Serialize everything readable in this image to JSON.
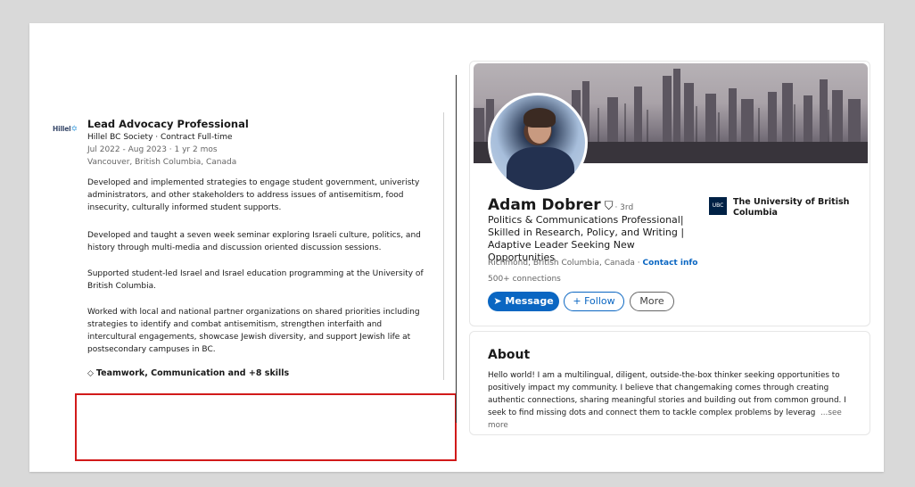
{
  "experience": {
    "logo_text": "Hillel",
    "title": "Lead Advocacy Professional",
    "company": "Hillel BC Society · Contract Full-time",
    "dates": "Jul 2022 - Aug 2023 · 1 yr 2 mos",
    "location": "Vancouver, British Columbia, Canada",
    "paragraphs": [
      "Developed and implemented strategies to engage student government, univeristy administrators, and other stakeholders to address issues of antisemitism, food insecurity, culturally informed student supports.",
      "Developed and taught a seven week seminar exploring Israeli culture, politics, and history through multi-media and discussion oriented discussion sessions.",
      "Supported student-led Israel and Israel education programming at the University of British Columbia.",
      "Worked with local and national partner organizations on shared priorities including strategies to identify and combat antisemitism, strengthen interfaith and intercultural engagements, showcase Jewish diversity, and support Jewish life at postsecondary campuses in BC."
    ],
    "skills": "Teamwork, Communication and +8 skills",
    "skills_icon": "diamond-icon"
  },
  "profile": {
    "name": "Adam Dobrer",
    "verified_icon": "verified-shield-icon",
    "degree": "· 3rd",
    "headline": "Politics & Communications Professional| Skilled in Research, Policy, and Writing | Adaptive Leader Seeking New Opportunities",
    "location": "Richmond, British Columbia, Canada · ",
    "contact_info": "Contact info",
    "connections": "500+ connections",
    "buttons": {
      "message": "Message",
      "follow": "Follow",
      "more": "More"
    },
    "university": "The University of British Columbia",
    "university_logo": "UBC"
  },
  "about": {
    "title": "About",
    "text": "Hello world! I am a multilingual, diligent, outside-the-box thinker seeking opportunities to positively impact my community. I believe that changemaking comes through creating authentic connections, sharing meaningful stories and building out from common ground. I seek to find missing dots and connect them to tackle complex problems by leverag",
    "see_more": "...see more"
  },
  "colors": {
    "linkedin_blue": "#0a66c2",
    "highlight_red": "#d11a1a"
  }
}
